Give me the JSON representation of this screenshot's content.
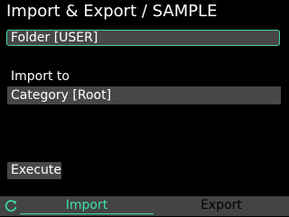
{
  "header": {
    "title": "Import & Export / SAMPLE"
  },
  "folder": {
    "value": "Folder [USER]"
  },
  "import": {
    "label": "Import to",
    "category_value": "Category [Root]"
  },
  "actions": {
    "execute_label": "Execute"
  },
  "footer": {
    "refresh_icon": "refresh-icon",
    "tabs": [
      {
        "label": "Import",
        "active": true
      },
      {
        "label": "Export",
        "active": false
      }
    ]
  },
  "colors": {
    "accent": "#3ee0b0",
    "field_background": "#474747",
    "footer_background": "#444444",
    "background": "#000000"
  }
}
